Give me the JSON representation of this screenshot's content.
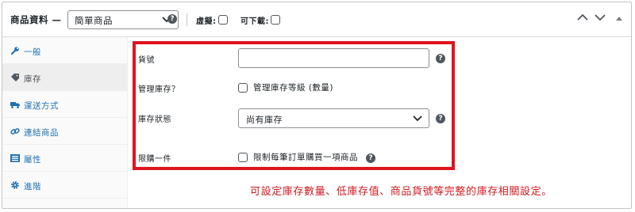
{
  "header": {
    "title": "商品資料 —",
    "product_type": {
      "selected": "簡單商品"
    },
    "virtual_label": "虛擬:",
    "downloadable_label": "可下載:"
  },
  "sidebar": {
    "items": [
      {
        "label": "一般",
        "icon": "wrench-icon",
        "active": false
      },
      {
        "label": "庫存",
        "icon": "tag-icon",
        "active": true
      },
      {
        "label": "運送方式",
        "icon": "truck-icon",
        "active": false
      },
      {
        "label": "連結商品",
        "icon": "link-icon",
        "active": false
      },
      {
        "label": "屬性",
        "icon": "list-icon",
        "active": false
      },
      {
        "label": "進階",
        "icon": "gear-icon",
        "active": false
      }
    ]
  },
  "inventory": {
    "sku_label": "貨號",
    "sku_value": "",
    "manage_stock_label": "管理庫存？",
    "manage_stock_checkbox_label": "管理庫存等級 (數量)",
    "stock_status_label": "庫存狀態",
    "stock_status_value": "尚有庫存",
    "sold_individually_label": "限購一件",
    "sold_individually_checkbox_label": "限制每筆訂單購買一項商品"
  },
  "annotation": "可設定庫存數量、低庫存值、商品貨號等完整的庫存相關設定。",
  "colors": {
    "highlight": "#e0141e",
    "annotation_text": "#d01a1f",
    "link": "#2271b1"
  }
}
